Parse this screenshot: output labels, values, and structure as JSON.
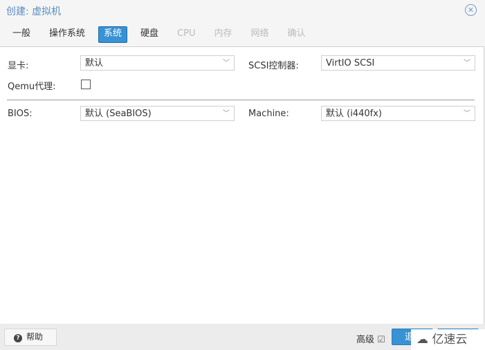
{
  "window": {
    "title": "创建: 虚拟机",
    "close_icon": "close-circle-icon"
  },
  "tabs": [
    {
      "label": "一般",
      "state": "normal"
    },
    {
      "label": "操作系统",
      "state": "normal"
    },
    {
      "label": "系统",
      "state": "active"
    },
    {
      "label": "硬盘",
      "state": "normal"
    },
    {
      "label": "CPU",
      "state": "disabled"
    },
    {
      "label": "内存",
      "state": "disabled"
    },
    {
      "label": "网络",
      "state": "disabled"
    },
    {
      "label": "确认",
      "state": "disabled"
    }
  ],
  "form": {
    "graphics_label": "显卡:",
    "graphics_value": "默认",
    "scsi_label": "SCSI控制器:",
    "scsi_value": "VirtIO SCSI",
    "qemu_agent_label": "Qemu代理:",
    "qemu_agent_checked": false,
    "bios_label": "BIOS:",
    "bios_value": "默认 (SeaBIOS)",
    "machine_label": "Machine:",
    "machine_value": "默认 (i440fx)"
  },
  "footer": {
    "help_label": "帮助",
    "advanced_label": "高级",
    "advanced_checked": true,
    "back_label": "退",
    "next_label": ""
  },
  "watermark": "亿速云"
}
